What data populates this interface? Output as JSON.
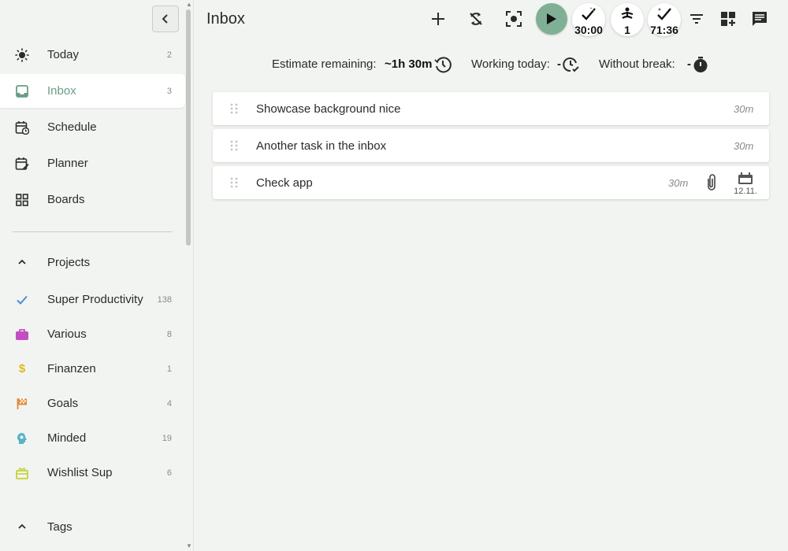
{
  "header": {
    "title": "Inbox",
    "buttons": {
      "add": "add-task",
      "sync": "sync-disabled",
      "focus": "focus-mode",
      "play": "start-tracking",
      "pomodoro_timer": "30:00",
      "break_counter": "1",
      "total_timer": "71:36",
      "filter": "filter",
      "add_widget": "add-widget",
      "notes": "notes"
    }
  },
  "stats": {
    "estimate_label": "Estimate remaining:",
    "estimate_value": "~1h 30m",
    "working_label": "Working today:",
    "working_value": "-",
    "break_label": "Without break:",
    "break_value": "-"
  },
  "sidebar": {
    "items": [
      {
        "label": "Today",
        "count": "2",
        "icon": "sun-icon"
      },
      {
        "label": "Inbox",
        "count": "3",
        "icon": "inbox-icon"
      },
      {
        "label": "Schedule",
        "count": "",
        "icon": "calendar-clock-icon"
      },
      {
        "label": "Planner",
        "count": "",
        "icon": "calendar-edit-icon"
      },
      {
        "label": "Boards",
        "count": "",
        "icon": "grid-icon"
      }
    ],
    "projects_label": "Projects",
    "projects": [
      {
        "label": "Super Productivity",
        "count": "138",
        "icon": "check-icon",
        "color": "#4a8ed9"
      },
      {
        "label": "Various",
        "count": "8",
        "icon": "briefcase-icon",
        "color": "#c24fc2"
      },
      {
        "label": "Finanzen",
        "count": "1",
        "icon": "dollar-icon",
        "color": "#e3b81d"
      },
      {
        "label": "Goals",
        "count": "4",
        "icon": "flag-icon",
        "color": "#e58a3a"
      },
      {
        "label": "Minded",
        "count": "19",
        "icon": "head-icon",
        "color": "#59b3c7"
      },
      {
        "label": "Wishlist Sup",
        "count": "6",
        "icon": "gift-icon",
        "color": "#c4d337"
      }
    ],
    "tags_label": "Tags"
  },
  "tasks": [
    {
      "title": "Showcase background nice",
      "estimate": "30m"
    },
    {
      "title": "Another task in the inbox",
      "estimate": "30m"
    },
    {
      "title": "Check app",
      "estimate": "30m",
      "due": "12.11."
    }
  ],
  "colors": {
    "accent": "#6a9d86",
    "play": "#7fb095",
    "background": "#f2f4f1"
  }
}
